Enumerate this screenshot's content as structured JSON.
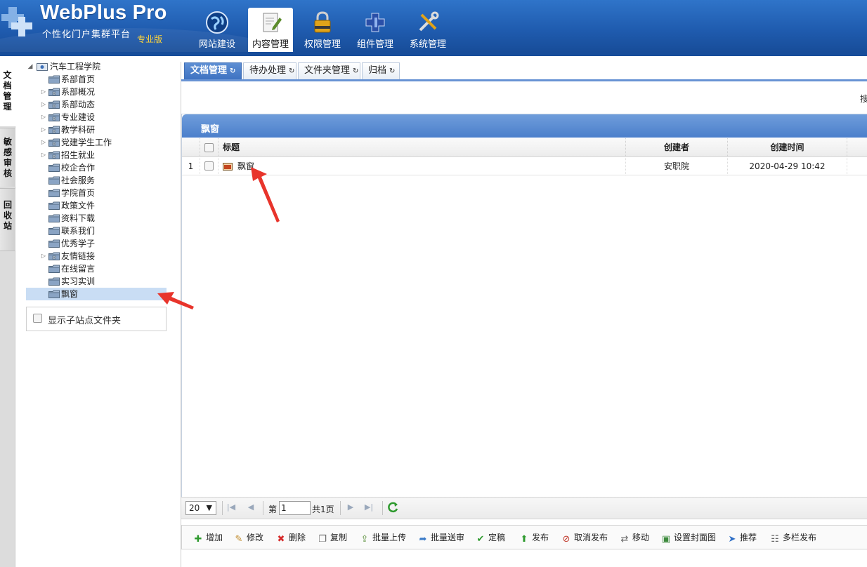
{
  "brand": {
    "title": "WebPlus Pro",
    "subtitle": "个性化门户集群平台",
    "edition": "专业版"
  },
  "nav": [
    {
      "label": "网站建设",
      "icon": "globe-icon"
    },
    {
      "label": "内容管理",
      "icon": "document-edit-icon",
      "active": true
    },
    {
      "label": "权限管理",
      "icon": "lock-icon"
    },
    {
      "label": "组件管理",
      "icon": "component-puzzle-icon"
    },
    {
      "label": "系统管理",
      "icon": "tools-icon"
    }
  ],
  "side_tabs": [
    {
      "label": "文档管理",
      "active": true
    },
    {
      "label": "敏感审核"
    },
    {
      "label": "回收站"
    }
  ],
  "tree": {
    "root": "汽车工程学院",
    "items": [
      {
        "label": "系部首页",
        "expandable": false
      },
      {
        "label": "系部概况",
        "expandable": true
      },
      {
        "label": "系部动态",
        "expandable": true
      },
      {
        "label": "专业建设",
        "expandable": true
      },
      {
        "label": "教学科研",
        "expandable": true
      },
      {
        "label": "党建学生工作",
        "expandable": true
      },
      {
        "label": "招生就业",
        "expandable": true
      },
      {
        "label": "校企合作",
        "expandable": false
      },
      {
        "label": "社会服务",
        "expandable": false
      },
      {
        "label": "学院首页",
        "expandable": false
      },
      {
        "label": "政策文件",
        "expandable": false
      },
      {
        "label": "资料下载",
        "expandable": false
      },
      {
        "label": "联系我们",
        "expandable": false
      },
      {
        "label": "优秀学子",
        "expandable": false
      },
      {
        "label": "友情链接",
        "expandable": true
      },
      {
        "label": "在线留言",
        "expandable": false
      },
      {
        "label": "实习实训",
        "expandable": false
      },
      {
        "label": "飘窗",
        "expandable": false,
        "selected": true
      }
    ],
    "show_sub_label": "显示子站点文件夹"
  },
  "tabs": [
    {
      "label": "文档管理",
      "active": true
    },
    {
      "label": "待办处理"
    },
    {
      "label": "文件夹管理"
    },
    {
      "label": "归档"
    }
  ],
  "search_partial": "搜",
  "panel": {
    "title": "飘窗",
    "columns": {
      "title": "标题",
      "creator": "创建者",
      "created": "创建时间"
    },
    "rows": [
      {
        "num": "1",
        "title": "飘窗",
        "creator": "安职院",
        "created": "2020-04-29 10:42"
      }
    ]
  },
  "pager": {
    "page_size": "20",
    "page_prefix": "第",
    "page_value": "1",
    "total": "共1页"
  },
  "toolbar": [
    {
      "label": "增加",
      "icon": "plus-icon",
      "color": "#2e9a2e"
    },
    {
      "label": "修改",
      "icon": "pencil-icon",
      "color": "#c08a2a"
    },
    {
      "label": "删除",
      "icon": "delete-x-icon",
      "color": "#d62b2b"
    },
    {
      "label": "复制",
      "icon": "copy-icon",
      "color": "#666666"
    },
    {
      "label": "批量上传",
      "icon": "batch-upload-icon",
      "color": "#5a8f3c"
    },
    {
      "label": "批量送审",
      "icon": "batch-submit-icon",
      "color": "#3b7bc8"
    },
    {
      "label": "定稿",
      "icon": "check-icon",
      "color": "#2e9a2e"
    },
    {
      "label": "发布",
      "icon": "publish-icon",
      "color": "#2e9a2e"
    },
    {
      "label": "取消发布",
      "icon": "unpublish-icon",
      "color": "#c0392b"
    },
    {
      "label": "移动",
      "icon": "move-icon",
      "color": "#666666"
    },
    {
      "label": "设置封面图",
      "icon": "cover-image-icon",
      "color": "#3d8a3d"
    },
    {
      "label": "推荐",
      "icon": "recommend-icon",
      "color": "#2f6fc6"
    },
    {
      "label": "多栏发布",
      "icon": "multi-column-icon",
      "color": "#666666"
    }
  ],
  "colors": {
    "header": "#1f5bae",
    "accent": "#4b7fcb",
    "selection": "#c9ddf4",
    "annotation_arrow": "#e8342b"
  }
}
